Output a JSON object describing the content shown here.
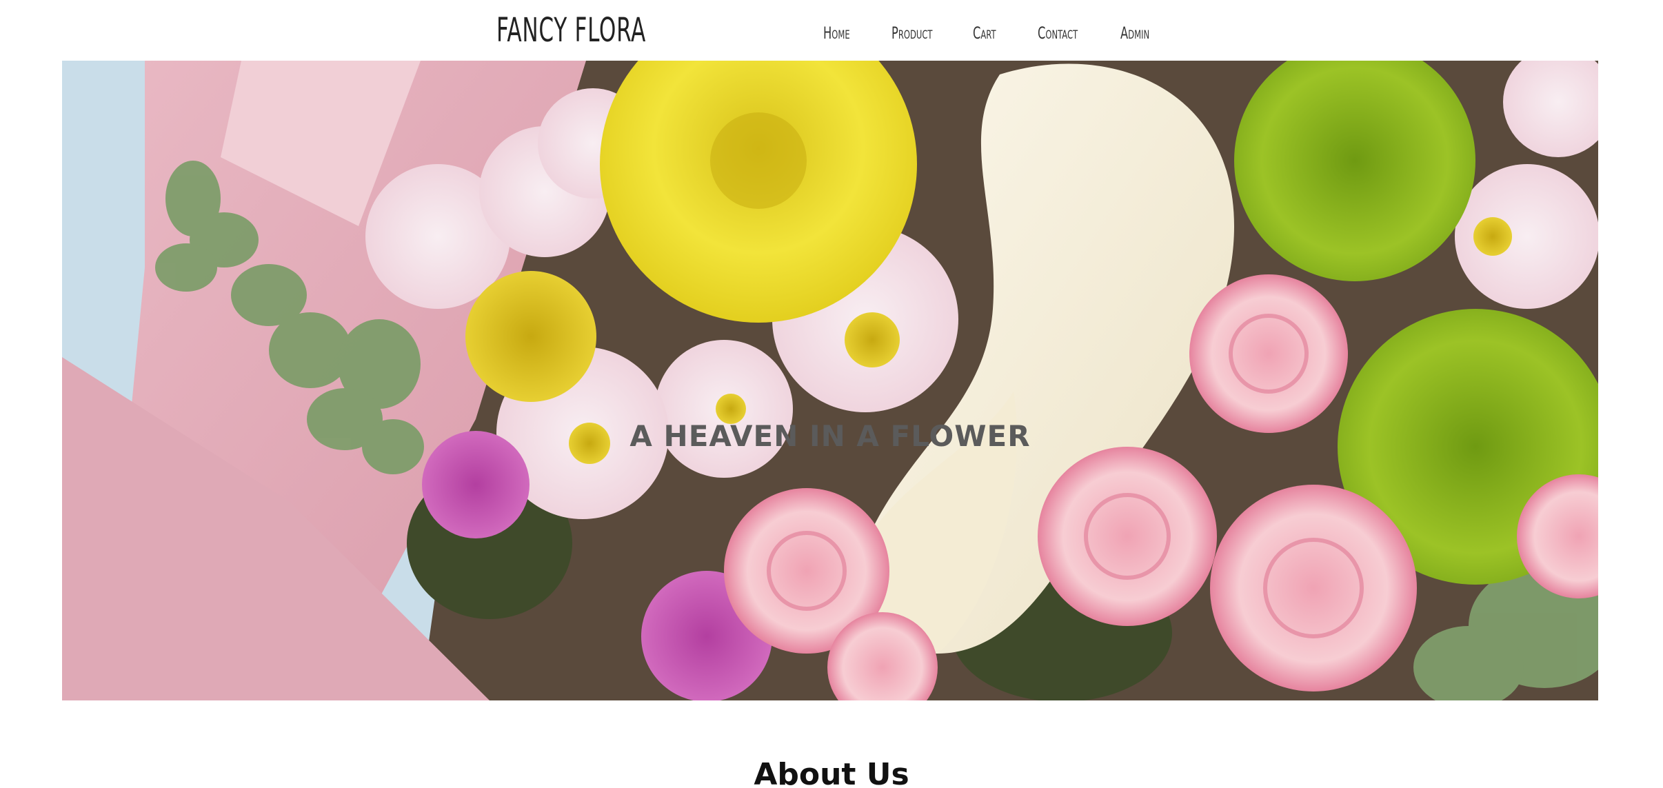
{
  "header": {
    "brand": "FANCY FLORA",
    "nav": [
      "Home",
      "Product",
      "Cart",
      "Contact",
      "Admin"
    ]
  },
  "hero": {
    "title": "A HEAVEN IN A FLOWER",
    "image": "flower-bouquet-image"
  },
  "about": {
    "title": "About Us"
  },
  "colors": {
    "background": "#ffffff",
    "hero_text": "#5b5b5b",
    "heading": "#111111"
  }
}
